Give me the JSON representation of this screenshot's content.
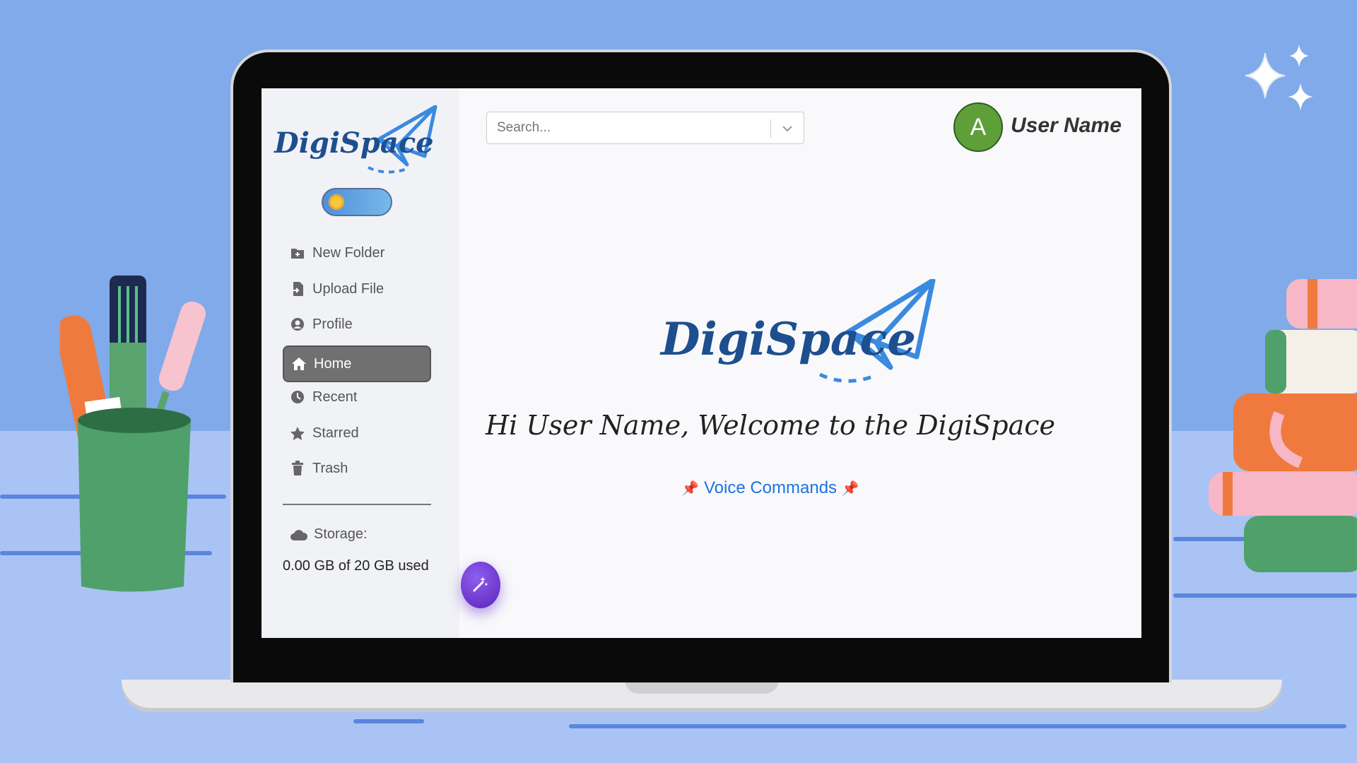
{
  "app": {
    "logo_text": "DigiSpace"
  },
  "search": {
    "placeholder": "Search..."
  },
  "user": {
    "avatar_initial": "A",
    "name": "User Name"
  },
  "sidebar": {
    "items": [
      {
        "label": "New Folder",
        "icon": "folder-plus-icon"
      },
      {
        "label": "Upload File",
        "icon": "file-upload-icon"
      },
      {
        "label": "Profile",
        "icon": "user-circle-icon"
      },
      {
        "label": "Home",
        "icon": "home-icon",
        "active": true
      },
      {
        "label": "Recent",
        "icon": "clock-icon"
      },
      {
        "label": "Starred",
        "icon": "star-icon"
      },
      {
        "label": "Trash",
        "icon": "trash-icon"
      }
    ],
    "storage_label": "Storage:",
    "storage_text": "0.00 GB of 20 GB used"
  },
  "main": {
    "welcome": "Hi User Name, Welcome to the DigiSpace",
    "voice_commands": "Voice Commands"
  },
  "colors": {
    "background": "#80aae9",
    "brand_blue": "#1d4f8f",
    "accent_link": "#1a73e8",
    "active_nav": "#707070",
    "avatar": "#5e9f3a"
  }
}
